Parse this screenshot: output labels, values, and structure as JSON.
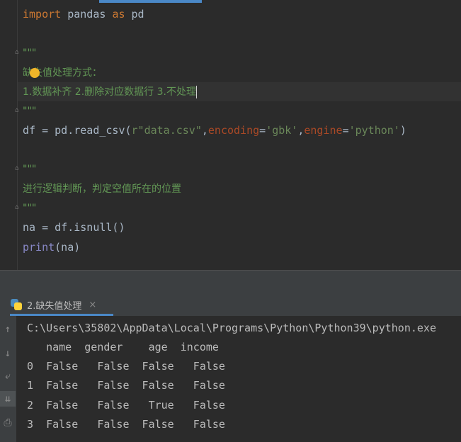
{
  "editor": {
    "lines": [
      {
        "parts": [
          {
            "t": "import",
            "c": "kw"
          },
          {
            "t": " pandas "
          },
          {
            "t": "as",
            "c": "kw"
          },
          {
            "t": " pd"
          }
        ]
      },
      {
        "parts": []
      },
      {
        "parts": [
          {
            "t": "\"\"\"",
            "c": "cmt"
          }
        ]
      },
      {
        "parts": [
          {
            "t": "缺失值处理方式：",
            "c": "cmt"
          }
        ]
      },
      {
        "parts": [
          {
            "t": "1.数据补齐 2.删除对应数据行 3.不处理",
            "c": "cmt"
          }
        ]
      },
      {
        "parts": [
          {
            "t": "\"\"\"",
            "c": "cmt"
          }
        ]
      },
      {
        "parts": [
          {
            "t": "df = pd.read_csv("
          },
          {
            "t": "r\"data.csv\"",
            "c": "str"
          },
          {
            "t": ","
          },
          {
            "t": "encoding",
            "c": "param"
          },
          {
            "t": "="
          },
          {
            "t": "'gbk'",
            "c": "str"
          },
          {
            "t": ","
          },
          {
            "t": "engine",
            "c": "param"
          },
          {
            "t": "="
          },
          {
            "t": "'python'",
            "c": "str"
          },
          {
            "t": ")"
          }
        ]
      },
      {
        "parts": []
      },
      {
        "parts": [
          {
            "t": "\"\"\"",
            "c": "cmt"
          }
        ]
      },
      {
        "parts": [
          {
            "t": "进行逻辑判断，判定空值所在的位置",
            "c": "cmt"
          }
        ]
      },
      {
        "parts": [
          {
            "t": "\"\"\"",
            "c": "cmt"
          }
        ]
      },
      {
        "parts": [
          {
            "t": "na = df.isnull()"
          }
        ]
      },
      {
        "parts": [
          {
            "t": "print",
            "c": "fn"
          },
          {
            "t": "(na)"
          }
        ]
      }
    ]
  },
  "run": {
    "tab_label": "2.缺失值处理",
    "close": "×"
  },
  "console": {
    "path": "C:\\Users\\35802\\AppData\\Local\\Programs\\Python\\Python39\\python.exe",
    "header": "   name  gender    age  income",
    "rows": [
      "0  False   False  False   False",
      "1  False   False  False   False",
      "2  False   False   True   False",
      "3  False   False  False   False"
    ]
  },
  "icons": {
    "up": "↑",
    "down": "↓",
    "wrap": "⤶",
    "sort": "⇊",
    "print": "⎙"
  }
}
